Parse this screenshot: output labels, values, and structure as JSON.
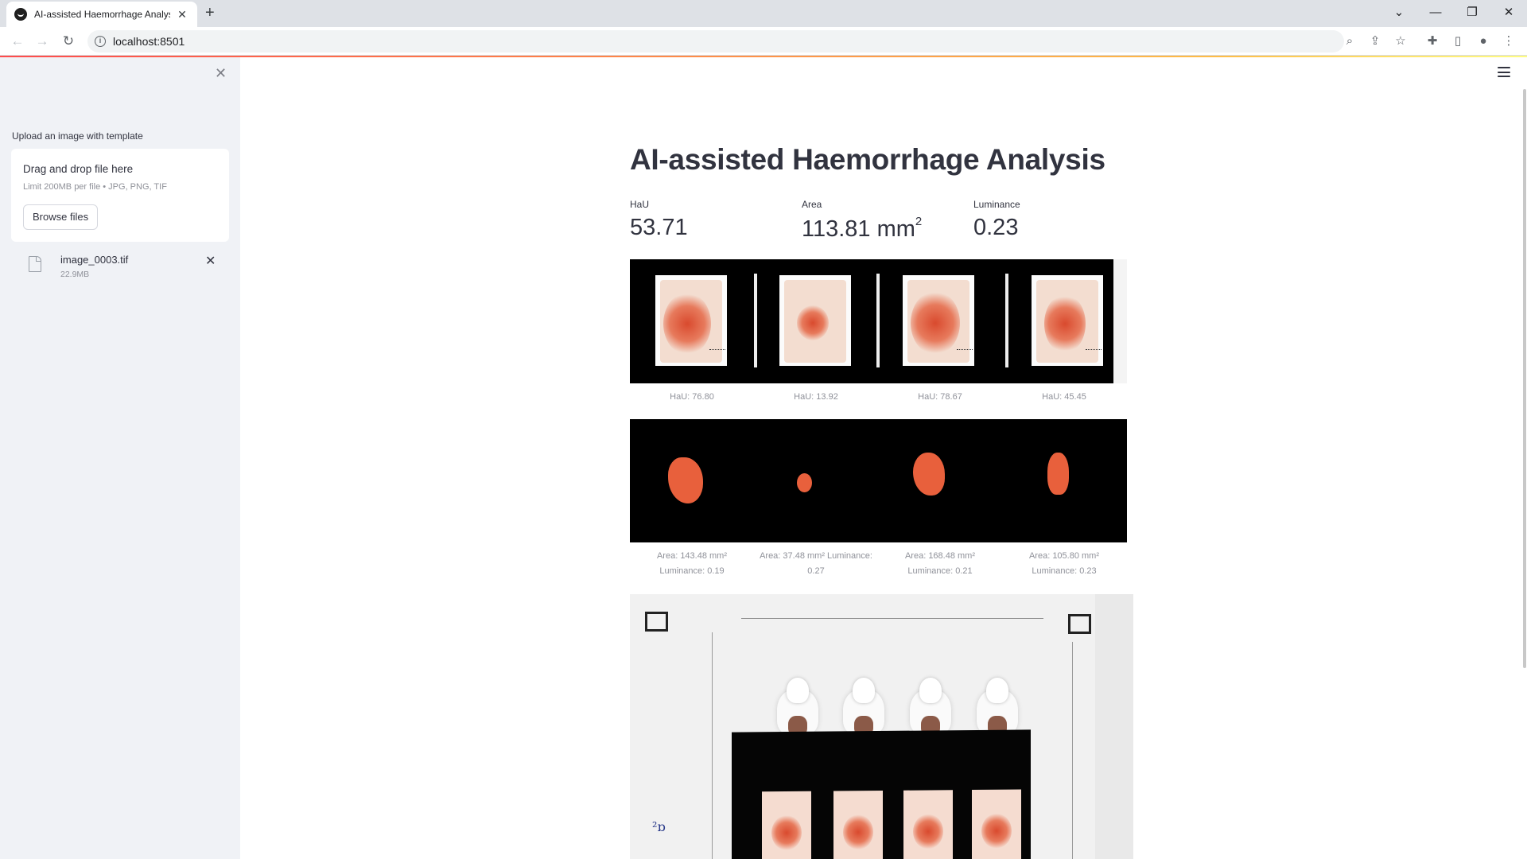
{
  "browser": {
    "tab_title": "AI-assisted Haemorrhage Analysis",
    "url": "localhost:8501"
  },
  "sidebar": {
    "upload_label": "Upload an image with template",
    "dropzone_title": "Drag and drop file here",
    "dropzone_limit": "Limit 200MB per file • JPG, PNG, TIF",
    "browse_button": "Browse files",
    "file_name": "image_0003.tif",
    "file_size": "22.9MB"
  },
  "main": {
    "title": "AI-assisted Haemorrhage Analysis",
    "metrics": [
      {
        "label": "HaU",
        "value": "53.71",
        "unit": ""
      },
      {
        "label": "Area",
        "value": "113.81 mm",
        "unit": "2"
      },
      {
        "label": "Luminance",
        "value": "0.23",
        "unit": ""
      }
    ],
    "hau_captions": [
      "HaU: 76.80",
      "HaU: 13.92",
      "HaU: 78.67",
      "HaU: 45.45"
    ],
    "area_captions": [
      {
        "area": "Area: 143.48 mm²",
        "luminance": "Luminance: 0.19"
      },
      {
        "area": "Area: 37.48 mm² Luminance:",
        "luminance": "0.27"
      },
      {
        "area": "Area: 168.48 mm²",
        "luminance": "Luminance: 0.21"
      },
      {
        "area": "Area: 105.80 mm²",
        "luminance": "Luminance: 0.23"
      }
    ],
    "photo_handwriting": "²ɒ"
  }
}
